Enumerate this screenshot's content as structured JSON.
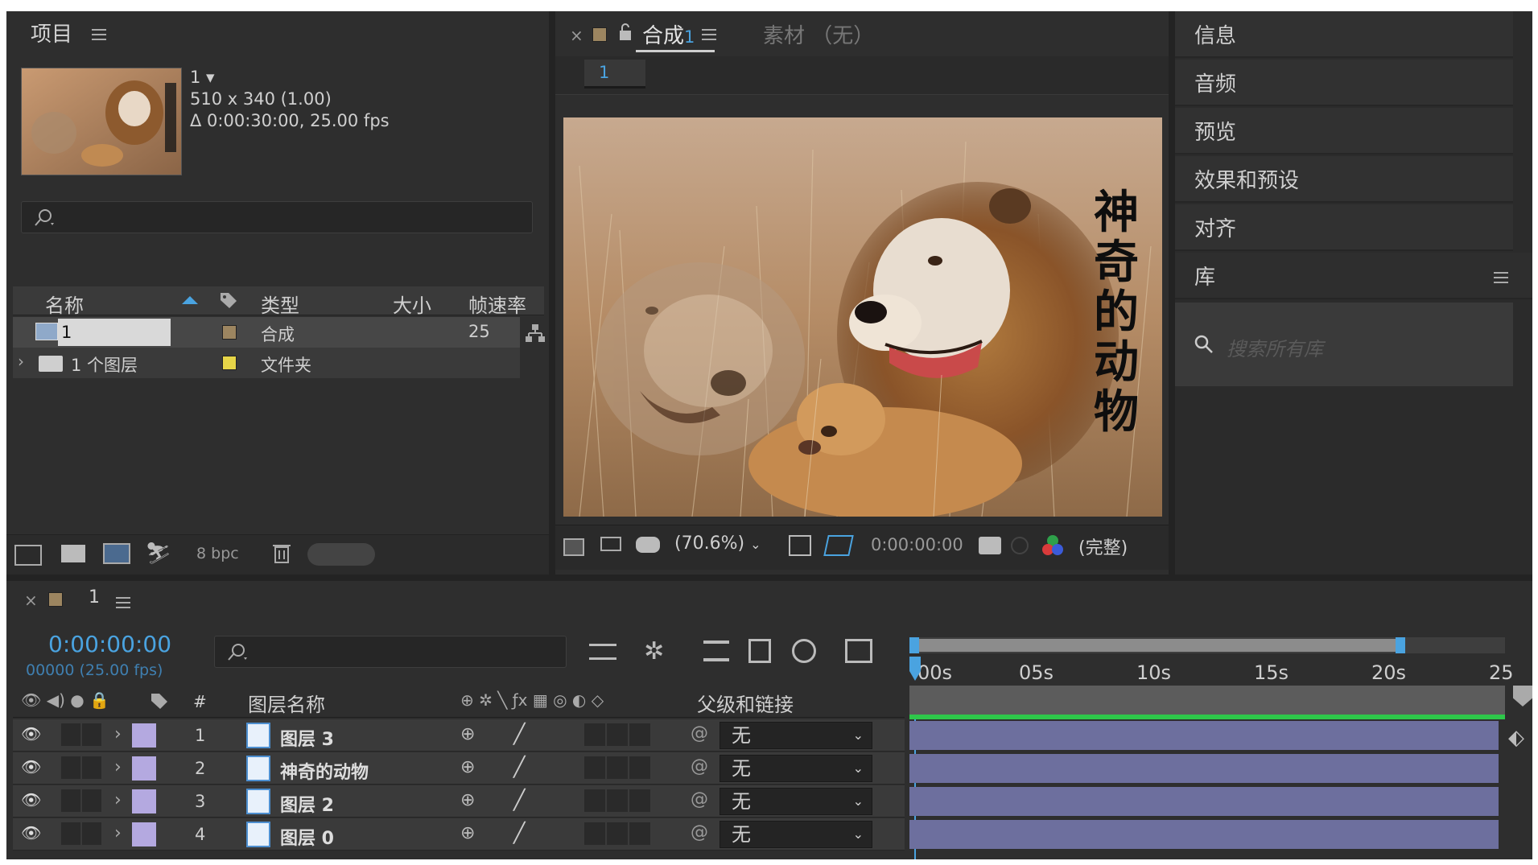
{
  "project": {
    "title": "项目",
    "comp_name": "1",
    "dims": "510 x 340 (1.00)",
    "duration": "Δ 0:00:30:00, 25.00 fps",
    "bit_depth": "8 bpc",
    "columns": {
      "name": "名称",
      "type": "类型",
      "size": "大小",
      "fps": "帧速率"
    },
    "items": [
      {
        "name": "1",
        "type": "合成",
        "fps": "25",
        "swatch": "#9c8560"
      },
      {
        "name": "1 个图层",
        "type": "文件夹",
        "fps": "",
        "swatch": "#e6d548"
      }
    ]
  },
  "comp": {
    "tab_label": "合成",
    "tab_num": "1",
    "footage_tab": "素材 （无）",
    "subtab": "1",
    "overlay_text": "神奇的动物",
    "zoom": "(70.6%)",
    "timecode": "0:00:00:00",
    "resolution": "(完整)"
  },
  "right_panel": {
    "items": [
      "信息",
      "音频",
      "预览",
      "效果和预设",
      "对齐"
    ],
    "library": "库",
    "search_placeholder": "搜索所有库"
  },
  "timeline": {
    "tab": "1",
    "timecode": "0:00:00:00",
    "frames": "00000 (25.00 fps)",
    "col_hash": "#",
    "col_layer_name": "图层名称",
    "col_parent": "父级和链接",
    "ticks": [
      "00s",
      "05s",
      "10s",
      "15s",
      "20s",
      "25"
    ],
    "layers": [
      {
        "num": "1",
        "name": "图层 3",
        "parent": "无"
      },
      {
        "num": "2",
        "name": "神奇的动物",
        "parent": "无"
      },
      {
        "num": "3",
        "name": "图层 2",
        "parent": "无"
      },
      {
        "num": "4",
        "name": "图层 0",
        "parent": "无"
      }
    ],
    "label_color": "#b4a9e0",
    "bar_color": "#6d6f9e"
  }
}
